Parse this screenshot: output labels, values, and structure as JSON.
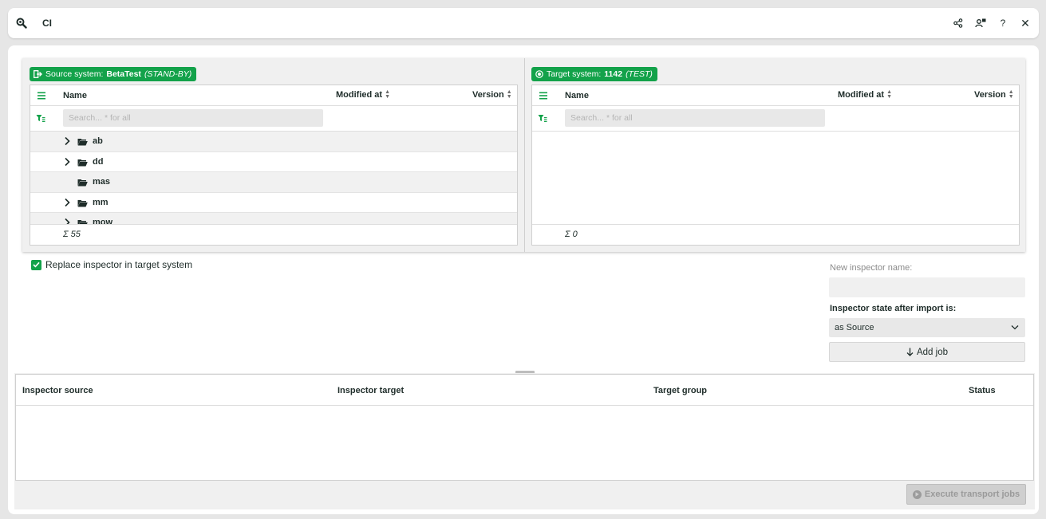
{
  "header": {
    "title": "CI",
    "icons": [
      "search-icon",
      "share-icon",
      "user-settings-icon",
      "help-icon",
      "close-icon"
    ],
    "help_glyph": "?",
    "close_glyph": "✕"
  },
  "source": {
    "badge_label": "Source system:",
    "system_name": "BetaTest",
    "system_state": "(STAND-BY)",
    "columns": {
      "name": "Name",
      "modified": "Modified at",
      "version": "Version"
    },
    "search_placeholder": "Search... * for all",
    "rows": [
      {
        "label": "ab",
        "expandable": true
      },
      {
        "label": "dd",
        "expandable": true
      },
      {
        "label": "mas",
        "expandable": false
      },
      {
        "label": "mm",
        "expandable": true
      },
      {
        "label": "mow",
        "expandable": true
      }
    ],
    "sum": "Σ 55"
  },
  "target": {
    "badge_label": "Target system:",
    "system_name": "1142",
    "system_state": "(TEST)",
    "columns": {
      "name": "Name",
      "modified": "Modified at",
      "version": "Version"
    },
    "search_placeholder": "Search... * for all",
    "sum": "Σ 0"
  },
  "options": {
    "replace_label": "Replace inspector in target system",
    "replace_checked": true,
    "new_name_label": "New inspector name:",
    "new_name_value": "",
    "state_label": "Inspector state after import is:",
    "state_value": "as Source",
    "add_job_label": "Add job"
  },
  "jobs": {
    "columns": [
      "Inspector source",
      "Inspector target",
      "Target group",
      "Status"
    ],
    "execute_label": "Execute transport jobs"
  },
  "colors": {
    "accent": "#13a24a",
    "text": "#1f2d2a"
  }
}
